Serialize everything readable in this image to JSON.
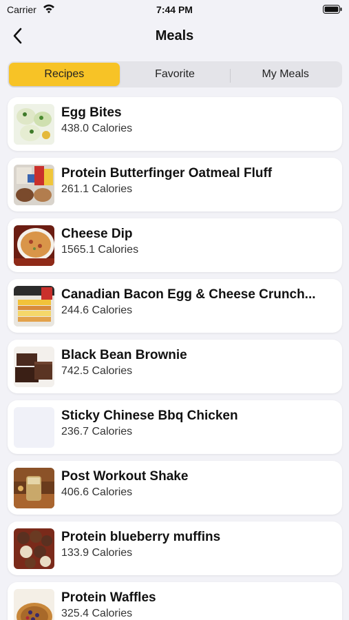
{
  "status_bar": {
    "carrier": "Carrier",
    "time": "7:44 PM"
  },
  "nav": {
    "title": "Meals"
  },
  "tabs": [
    {
      "label": "Recipes",
      "active": true
    },
    {
      "label": "Favorite",
      "active": false
    },
    {
      "label": "My Meals",
      "active": false
    }
  ],
  "meals": [
    {
      "name": "Egg Bites",
      "calories": "438.0 Calories"
    },
    {
      "name": "Protein Butterfinger Oatmeal Fluff",
      "calories": "261.1 Calories"
    },
    {
      "name": "Cheese Dip",
      "calories": "1565.1 Calories"
    },
    {
      "name": "Canadian Bacon Egg & Cheese Crunch...",
      "calories": "244.6 Calories"
    },
    {
      "name": "Black Bean Brownie",
      "calories": "742.5 Calories"
    },
    {
      "name": "Sticky Chinese Bbq Chicken",
      "calories": "236.7 Calories"
    },
    {
      "name": "Post Workout Shake",
      "calories": "406.6 Calories"
    },
    {
      "name": "Protein blueberry muffins",
      "calories": "133.9 Calories"
    },
    {
      "name": "Protein Waffles",
      "calories": "325.4 Calories"
    }
  ],
  "colors": {
    "accent": "#f7c326",
    "background": "#f2f2f7"
  }
}
